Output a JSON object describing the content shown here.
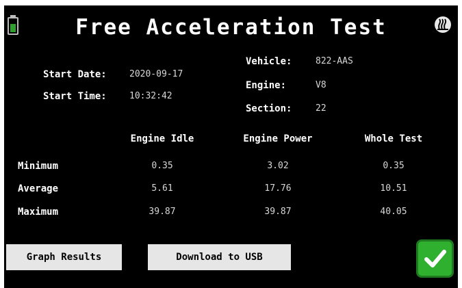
{
  "header": {
    "title": "Free Acceleration Test",
    "battery_icon": "battery-icon",
    "app_icon": "steam-logo-icon"
  },
  "info": {
    "start_date_label": "Start Date:",
    "start_date": "2020-09-17",
    "start_time_label": "Start Time:",
    "start_time": "10:32:42",
    "vehicle_label": "Vehicle:",
    "vehicle": "822-AAS",
    "engine_label": "Engine:",
    "engine": "V8",
    "section_label": "Section:",
    "section": "22"
  },
  "results": {
    "columns": [
      "Engine Idle",
      "Engine Power",
      "Whole Test"
    ],
    "rows": [
      {
        "label": "Minimum",
        "values": [
          "0.35",
          "3.02",
          "0.35"
        ]
      },
      {
        "label": "Average",
        "values": [
          "5.61",
          "17.76",
          "10.51"
        ]
      },
      {
        "label": "Maximum",
        "values": [
          "39.87",
          "39.87",
          "40.05"
        ]
      }
    ]
  },
  "buttons": {
    "graph_results": "Graph Results",
    "download_usb": "Download to USB",
    "confirm_icon": "checkmark-icon"
  },
  "colors": {
    "background": "#000000",
    "battery_green": "#2ea02e",
    "confirm_green": "#2fb02f",
    "button_gray": "#e6e6e6"
  }
}
